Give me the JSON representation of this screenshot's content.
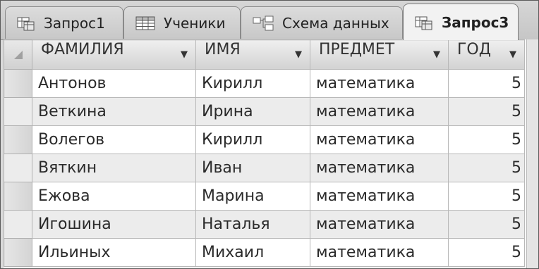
{
  "tabs": [
    {
      "label": "Запрос1",
      "icon": "query-icon",
      "active": false
    },
    {
      "label": "Ученики",
      "icon": "table-icon",
      "active": false
    },
    {
      "label": "Схема данных",
      "icon": "relationships-icon",
      "active": false
    },
    {
      "label": "Запрос3",
      "icon": "query-icon",
      "active": true
    }
  ],
  "grid": {
    "columns": [
      {
        "label": "ФАМИЛИЯ",
        "icon": "dropdown-arrow-icon"
      },
      {
        "label": "ИМЯ",
        "icon": "dropdown-arrow-icon"
      },
      {
        "label": "ПРЕДМЕТ",
        "icon": "dropdown-arrow-icon"
      },
      {
        "label": "ГОД",
        "icon": "dropdown-arrow-icon"
      }
    ],
    "rows": [
      {
        "surname": "Антонов",
        "name": "Кирилл",
        "subject": "математика",
        "year": "5"
      },
      {
        "surname": "Веткина",
        "name": "Ирина",
        "subject": "математика",
        "year": "5"
      },
      {
        "surname": "Волегов",
        "name": "Кирилл",
        "subject": "математика",
        "year": "5"
      },
      {
        "surname": "Вяткин",
        "name": "Иван",
        "subject": "математика",
        "year": "5"
      },
      {
        "surname": "Ежова",
        "name": "Марина",
        "subject": "математика",
        "year": "5"
      },
      {
        "surname": "Игошина",
        "name": "Наталья",
        "subject": "математика",
        "year": "5"
      },
      {
        "surname": "Ильиных",
        "name": "Михаил",
        "subject": "математика",
        "year": "5"
      }
    ]
  }
}
